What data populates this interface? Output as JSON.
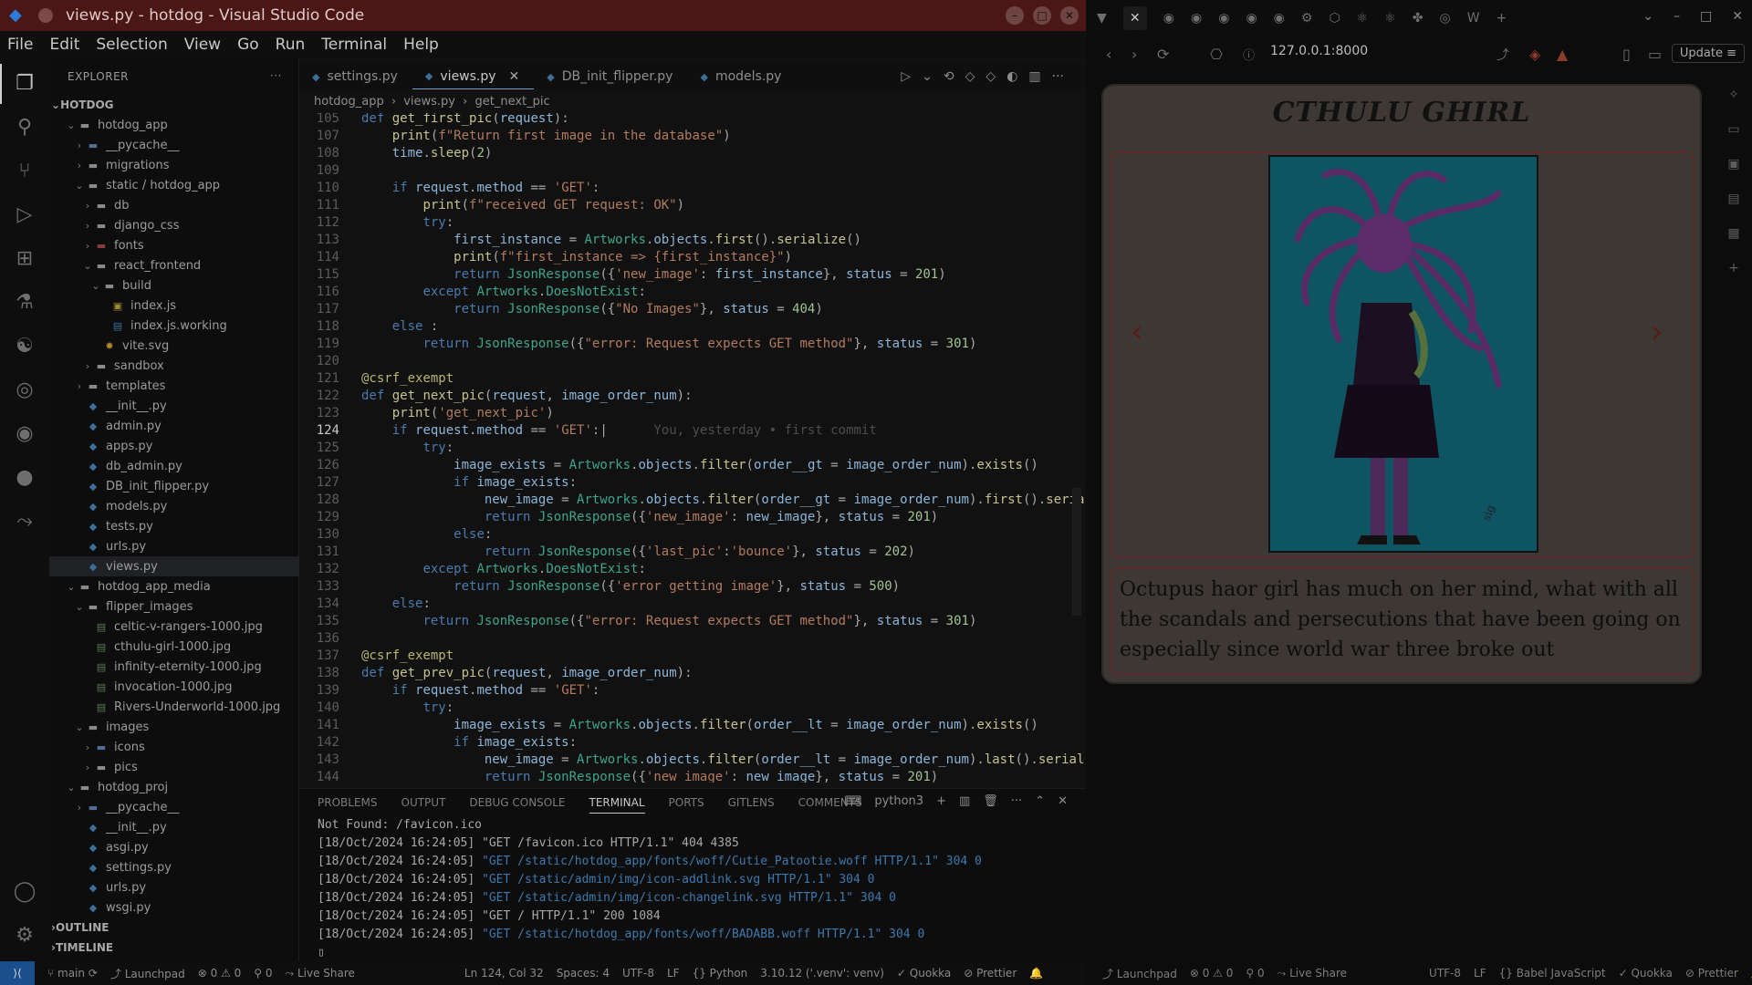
{
  "vscode": {
    "title": "views.py - hotdog - Visual Studio Code",
    "menu": [
      "File",
      "Edit",
      "Selection",
      "View",
      "Go",
      "Run",
      "Terminal",
      "Help"
    ],
    "explorer": {
      "header": "EXPLORER",
      "root": "HOTDOG",
      "tree": [
        {
          "label": "hotdog_app",
          "icon": "folder",
          "depth": 1,
          "chev": "open"
        },
        {
          "label": "__pycache__",
          "icon": "pkg",
          "depth": 2,
          "chev": "closed"
        },
        {
          "label": "migrations",
          "icon": "folder",
          "depth": 2,
          "chev": "closed"
        },
        {
          "label": "static / hotdog_app",
          "icon": "folder",
          "depth": 2,
          "chev": "open"
        },
        {
          "label": "db",
          "icon": "folder",
          "depth": 3,
          "chev": "closed"
        },
        {
          "label": "django_css",
          "icon": "folder",
          "depth": 3,
          "chev": "closed"
        },
        {
          "label": "fonts",
          "icon": "red",
          "depth": 3,
          "chev": "closed"
        },
        {
          "label": "react_frontend",
          "icon": "folder",
          "depth": 3,
          "chev": "open"
        },
        {
          "label": "build",
          "icon": "folder",
          "depth": 4,
          "chev": "open"
        },
        {
          "label": "index.js",
          "icon": "js",
          "depth": 5,
          "chev": ""
        },
        {
          "label": "index.js.working",
          "icon": "doc",
          "depth": 5,
          "chev": ""
        },
        {
          "label": "vite.svg",
          "icon": "svg",
          "depth": 4,
          "chev": ""
        },
        {
          "label": "sandbox",
          "icon": "folder",
          "depth": 3,
          "chev": "closed"
        },
        {
          "label": "templates",
          "icon": "folder",
          "depth": 2,
          "chev": "closed"
        },
        {
          "label": "__init__.py",
          "icon": "py",
          "depth": 2,
          "chev": ""
        },
        {
          "label": "admin.py",
          "icon": "py",
          "depth": 2,
          "chev": ""
        },
        {
          "label": "apps.py",
          "icon": "py",
          "depth": 2,
          "chev": ""
        },
        {
          "label": "db_admin.py",
          "icon": "py",
          "depth": 2,
          "chev": ""
        },
        {
          "label": "DB_init_flipper.py",
          "icon": "py",
          "depth": 2,
          "chev": ""
        },
        {
          "label": "models.py",
          "icon": "py",
          "depth": 2,
          "chev": ""
        },
        {
          "label": "tests.py",
          "icon": "py",
          "depth": 2,
          "chev": ""
        },
        {
          "label": "urls.py",
          "icon": "py",
          "depth": 2,
          "chev": ""
        },
        {
          "label": "views.py",
          "icon": "py",
          "depth": 2,
          "chev": "",
          "selected": true
        },
        {
          "label": "hotdog_app_media",
          "icon": "folder",
          "depth": 1,
          "chev": "open"
        },
        {
          "label": "flipper_images",
          "icon": "folder",
          "depth": 2,
          "chev": "open"
        },
        {
          "label": "celtic-v-rangers-1000.jpg",
          "icon": "jpg",
          "depth": 3,
          "chev": ""
        },
        {
          "label": "cthulu-girl-1000.jpg",
          "icon": "jpg",
          "depth": 3,
          "chev": ""
        },
        {
          "label": "infinity-eternity-1000.jpg",
          "icon": "jpg",
          "depth": 3,
          "chev": ""
        },
        {
          "label": "invocation-1000.jpg",
          "icon": "jpg",
          "depth": 3,
          "chev": ""
        },
        {
          "label": "Rivers-Underworld-1000.jpg",
          "icon": "jpg",
          "depth": 3,
          "chev": ""
        },
        {
          "label": "images",
          "icon": "folder",
          "depth": 2,
          "chev": "open"
        },
        {
          "label": "icons",
          "icon": "pkg",
          "depth": 3,
          "chev": "closed"
        },
        {
          "label": "pics",
          "icon": "folder",
          "depth": 3,
          "chev": "closed"
        },
        {
          "label": "hotdog_proj",
          "icon": "folder",
          "depth": 1,
          "chev": "open"
        },
        {
          "label": "__pycache__",
          "icon": "pkg",
          "depth": 2,
          "chev": "closed"
        },
        {
          "label": "__init__.py",
          "icon": "py",
          "depth": 2,
          "chev": ""
        },
        {
          "label": "asgi.py",
          "icon": "py",
          "depth": 2,
          "chev": ""
        },
        {
          "label": "settings.py",
          "icon": "py",
          "depth": 2,
          "chev": ""
        },
        {
          "label": "urls.py",
          "icon": "py",
          "depth": 2,
          "chev": ""
        },
        {
          "label": "wsgi.py",
          "icon": "py",
          "depth": 2,
          "chev": ""
        }
      ],
      "outline": "OUTLINE",
      "timeline": "TIMELINE"
    },
    "tabs": [
      {
        "label": "settings.py",
        "active": false
      },
      {
        "label": "views.py",
        "active": true
      },
      {
        "label": "DB_init_flipper.py",
        "active": false
      },
      {
        "label": "models.py",
        "active": false
      }
    ],
    "breadcrumb": [
      "hotdog_app",
      "views.py",
      "get_next_pic"
    ],
    "code": [
      {
        "n": "105",
        "html": "<span class='kw'>def</span> <span class='fn'>get_first_pic</span>(<span class='var'>request</span>):"
      },
      {
        "n": "107",
        "html": "    <span class='fn'>print</span>(<span class='st'>f\"Return first image in the database\"</span>)"
      },
      {
        "n": "108",
        "html": "    <span class='var'>time</span>.<span class='fn'>sleep</span>(<span class='num'>2</span>)"
      },
      {
        "n": "109",
        "html": ""
      },
      {
        "n": "110",
        "html": "    <span class='kw'>if</span> <span class='var'>request</span>.<span class='var'>method</span> == <span class='st'>'GET'</span>:"
      },
      {
        "n": "111",
        "html": "        <span class='fn'>print</span>(<span class='st'>f\"received GET request: OK\"</span>)"
      },
      {
        "n": "112",
        "html": "        <span class='kw'>try</span>:"
      },
      {
        "n": "113",
        "html": "            <span class='var'>first_instance</span> = <span class='cls'>Artworks</span>.<span class='var'>objects</span>.<span class='fn'>first</span>().<span class='fn'>serialize</span>()"
      },
      {
        "n": "114",
        "html": "            <span class='fn'>print</span>(<span class='st'>f\"first_instance => {first_instance}\"</span>)"
      },
      {
        "n": "115",
        "html": "            <span class='kw'>return</span> <span class='cls'>JsonResponse</span>({<span class='st'>'new_image'</span>: <span class='var'>first_instance</span>}, <span class='var'>status</span> = <span class='num'>201</span>)"
      },
      {
        "n": "116",
        "html": "        <span class='kw'>except</span> <span class='cls'>Artworks</span>.<span class='cls'>DoesNotExist</span>:"
      },
      {
        "n": "117",
        "html": "            <span class='kw'>return</span> <span class='cls'>JsonResponse</span>({<span class='st'>\"No Images\"</span>}, <span class='var'>status</span> = <span class='num'>404</span>)"
      },
      {
        "n": "118",
        "html": "    <span class='kw'>else</span> :"
      },
      {
        "n": "119",
        "html": "        <span class='kw'>return</span> <span class='cls'>JsonResponse</span>({<span class='st'>\"error: Request expects GET method\"</span>}, <span class='var'>status</span> = <span class='num'>301</span>)"
      },
      {
        "n": "120",
        "html": ""
      },
      {
        "n": "121",
        "html": "<span class='dec'>@csrf_exempt</span>"
      },
      {
        "n": "122",
        "html": "<span class='kw'>def</span> <span class='fn'>get_next_pic</span>(<span class='var'>request</span>, <span class='var'>image_order_num</span>):"
      },
      {
        "n": "123",
        "html": "    <span class='fn'>print</span>(<span class='st'>'get_next_pic'</span>)"
      },
      {
        "n": "124",
        "html": "    <span class='kw'>if</span> <span class='var'>request</span>.<span class='var'>method</span> == <span class='st'>'GET'</span>:|      <span class='blame'>You, yesterday • first commit</span>",
        "cur": true
      },
      {
        "n": "125",
        "html": "        <span class='kw'>try</span>:"
      },
      {
        "n": "126",
        "html": "            <span class='var'>image_exists</span> = <span class='cls'>Artworks</span>.<span class='var'>objects</span>.<span class='fn'>filter</span>(<span class='var'>order__gt</span> = <span class='var'>image_order_num</span>).<span class='fn'>exists</span>()"
      },
      {
        "n": "127",
        "html": "            <span class='kw'>if</span> <span class='var'>image_exists</span>:"
      },
      {
        "n": "128",
        "html": "                <span class='var'>new_image</span> = <span class='cls'>Artworks</span>.<span class='var'>objects</span>.<span class='fn'>filter</span>(<span class='var'>order__gt</span> = <span class='var'>image_order_num</span>).<span class='fn'>first</span>().<span class='fn'>seria</span>"
      },
      {
        "n": "129",
        "html": "                <span class='kw'>return</span> <span class='cls'>JsonResponse</span>({<span class='st'>'new_image'</span>: <span class='var'>new_image</span>}, <span class='var'>status</span> = <span class='num'>201</span>)"
      },
      {
        "n": "130",
        "html": "            <span class='kw'>else</span>:"
      },
      {
        "n": "131",
        "html": "                <span class='kw'>return</span> <span class='cls'>JsonResponse</span>({<span class='st'>'last_pic'</span>:<span class='st'>'bounce'</span>}, <span class='var'>status</span> = <span class='num'>202</span>)"
      },
      {
        "n": "132",
        "html": "        <span class='kw'>except</span> <span class='cls'>Artworks</span>.<span class='cls'>DoesNotExist</span>:"
      },
      {
        "n": "133",
        "html": "            <span class='kw'>return</span> <span class='cls'>JsonResponse</span>({<span class='st'>'error getting image'</span>}, <span class='var'>status</span> = <span class='num'>500</span>)"
      },
      {
        "n": "134",
        "html": "    <span class='kw'>else</span>:"
      },
      {
        "n": "135",
        "html": "        <span class='kw'>return</span> <span class='cls'>JsonResponse</span>({<span class='st'>\"error: Request expects GET method\"</span>}, <span class='var'>status</span> = <span class='num'>301</span>)"
      },
      {
        "n": "136",
        "html": ""
      },
      {
        "n": "137",
        "html": "<span class='dec'>@csrf_exempt</span>"
      },
      {
        "n": "138",
        "html": "<span class='kw'>def</span> <span class='fn'>get_prev_pic</span>(<span class='var'>request</span>, <span class='var'>image_order_num</span>):"
      },
      {
        "n": "139",
        "html": "    <span class='kw'>if</span> <span class='var'>request</span>.<span class='var'>method</span> == <span class='st'>'GET'</span>:"
      },
      {
        "n": "140",
        "html": "        <span class='kw'>try</span>:"
      },
      {
        "n": "141",
        "html": "            <span class='var'>image_exists</span> = <span class='cls'>Artworks</span>.<span class='var'>objects</span>.<span class='fn'>filter</span>(<span class='var'>order__lt</span> = <span class='var'>image_order_num</span>).<span class='fn'>exists</span>()"
      },
      {
        "n": "142",
        "html": "            <span class='kw'>if</span> <span class='var'>image_exists</span>:"
      },
      {
        "n": "143",
        "html": "                <span class='var'>new_image</span> = <span class='cls'>Artworks</span>.<span class='var'>objects</span>.<span class='fn'>filter</span>(<span class='var'>order__lt</span> = <span class='var'>image_order_num</span>).<span class='fn'>last</span>().<span class='fn'>serial</span>"
      },
      {
        "n": "144",
        "html": "                <span class='kw'>return</span> <span class='cls'>JsonResponse</span>({<span class='st'>'new_image'</span>: <span class='var'>new_image</span>}, <span class='var'>status</span> = <span class='num'>201</span>)"
      }
    ],
    "panel": {
      "tabs": [
        "PROBLEMS",
        "OUTPUT",
        "DEBUG CONSOLE",
        "TERMINAL",
        "PORTS",
        "GITLENS",
        "COMMENTS"
      ],
      "active_tab": "TERMINAL",
      "shell": "python3",
      "lines": [
        {
          "pre": "Not Found: /favicon.ico",
          "url": "",
          "post": ""
        },
        {
          "pre": "[18/Oct/2024 16:24:05] ",
          "url": "",
          "post": "\"GET /favicon.ico HTTP/1.1\" 404 4385"
        },
        {
          "pre": "[18/Oct/2024 16:24:05] ",
          "url": "\"GET /static/hotdog_app/fonts/woff/Cutie_Patootie.woff HTTP/1.1\" 304 0",
          "post": ""
        },
        {
          "pre": "[18/Oct/2024 16:24:05] ",
          "url": "\"GET /static/admin/img/icon-addlink.svg HTTP/1.1\" 304 0",
          "post": ""
        },
        {
          "pre": "[18/Oct/2024 16:24:05] ",
          "url": "\"GET /static/admin/img/icon-changelink.svg HTTP/1.1\" 304 0",
          "post": ""
        },
        {
          "pre": "[18/Oct/2024 16:24:05] ",
          "url": "",
          "post": "\"GET / HTTP/1.1\" 200 1084"
        },
        {
          "pre": "[18/Oct/2024 16:24:05] ",
          "url": "\"GET /static/hotdog_app/fonts/woff/BADABB.woff HTTP/1.1\" 304 0",
          "post": ""
        }
      ]
    },
    "status": {
      "branch": "main",
      "launchpad": "Launchpad",
      "problems": "⊗ 0 ⚠ 0",
      "ports": "⚲ 0",
      "liveshare": "Live Share",
      "cursor": "Ln 124, Col 32",
      "spaces": "Spaces: 4",
      "encoding": "UTF-8",
      "eol": "LF",
      "language": "Python",
      "interpreter": "3.10.12 ('.venv': venv)",
      "quokka": "Quokka",
      "prettier": "Prettier"
    }
  },
  "browser": {
    "url": "127.0.0.1:8000",
    "update_label": "Update",
    "page": {
      "title": "CTHULU GHIRL",
      "description": "Octupus haor girl has much on her mind, what with all the scandals and persecutions that have been going on especially since world war three broke out",
      "prev_symbol": "‹",
      "next_symbol": "›"
    },
    "status": {
      "launchpad": "Launchpad",
      "problems": "⊗ 0 ⚠ 0",
      "ports": "⚲ 0",
      "liveshare": "Live Share",
      "encoding": "UTF-8",
      "eol": "LF",
      "language": "Babel JavaScript",
      "quokka": "Quokka",
      "prettier": "Prettier"
    }
  }
}
